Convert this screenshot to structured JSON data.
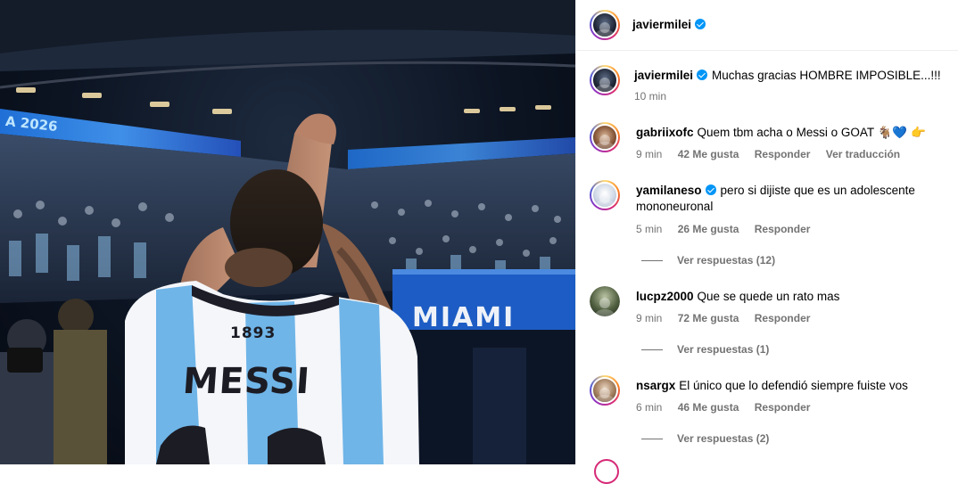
{
  "photo": {
    "alt": "",
    "jersey_name": "MESSI",
    "jersey_number": "1893",
    "stadium_sign": "MIAMI",
    "board_text": "A 2026"
  },
  "post": {
    "author": "javiermilei",
    "author_verified": true
  },
  "caption": {
    "username": "javiermilei",
    "verified": true,
    "text": "Muchas gracias HOMBRE IMPOSIBLE...!!!",
    "time": "10 min"
  },
  "comments": [
    {
      "username": "gabriixofc",
      "verified": false,
      "text": "Quem tbm acha o Messi o GOAT",
      "emojis": [
        "🐐",
        "💙",
        "👉"
      ],
      "time": "9 min",
      "likes": "42 Me gusta",
      "reply": "Responder",
      "translate": "Ver traducción"
    },
    {
      "username": "yamilaneso",
      "verified": true,
      "text": "pero si dijiste que es un adolescente mononeuronal",
      "time": "5 min",
      "likes": "26 Me gusta",
      "reply": "Responder",
      "replies": "Ver respuestas (12)"
    },
    {
      "username": "lucpz2000",
      "verified": false,
      "text": "Que se quede un rato mas",
      "time": "9 min",
      "likes": "72 Me gusta",
      "reply": "Responder",
      "replies": "Ver respuestas (1)"
    },
    {
      "username": "nsargx",
      "verified": false,
      "text": "El único que lo defendió siempre fuiste vos",
      "time": "6 min",
      "likes": "46 Me gusta",
      "reply": "Responder",
      "replies": "Ver respuestas (2)"
    }
  ]
}
